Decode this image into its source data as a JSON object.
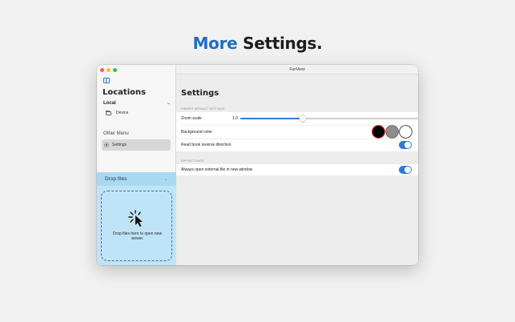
{
  "headline": {
    "accent": "More",
    "rest": "Settings."
  },
  "window": {
    "title": "FunView"
  },
  "sidebar": {
    "title": "Locations",
    "local_section": "Local",
    "device_item": "Device",
    "other_menu": "Other Menu",
    "settings_item": "Settings"
  },
  "drop": {
    "header": "Drop files",
    "text": "Drop files here to open new viewer."
  },
  "settings": {
    "title": "Settings",
    "viewer_section": "Viewer default settings",
    "zoom_label": "Zoom scale",
    "zoom_value": "1.0",
    "zoom_fraction": 0.35,
    "bg_label": "Background color",
    "bg_colors": [
      "#000000",
      "#8e8e8e",
      "#ffffff"
    ],
    "reverse_label": "Read book reverse direction",
    "reverse_on": true,
    "app_section": "App settings",
    "external_label": "Always open external file in new window",
    "external_on": true
  },
  "colors": {
    "accent": "#1f6fc0",
    "toggle": "#2f7ad6",
    "drop_bg": "#bfe4f8"
  }
}
